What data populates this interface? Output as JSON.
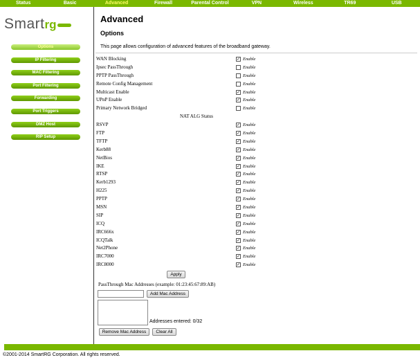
{
  "topnav": {
    "items": [
      {
        "label": "Status",
        "active": false
      },
      {
        "label": "Basic",
        "active": false
      },
      {
        "label": "Advanced",
        "active": true
      },
      {
        "label": "Firewall",
        "active": false
      },
      {
        "label": "Parental Control",
        "active": false
      },
      {
        "label": "VPN",
        "active": false
      },
      {
        "label": "Wireless",
        "active": false
      },
      {
        "label": "TR69",
        "active": false
      },
      {
        "label": "USB",
        "active": false
      }
    ]
  },
  "logo": {
    "text_main": "Smart",
    "text_accent": "rg"
  },
  "sidebar": {
    "items": [
      {
        "label": "Options",
        "active": true
      },
      {
        "label": "IP Filtering",
        "active": false
      },
      {
        "label": "MAC Filtering",
        "active": false
      },
      {
        "label": "Port Filtering",
        "active": false
      },
      {
        "label": "Forwarding",
        "active": false
      },
      {
        "label": "Port Triggers",
        "active": false
      },
      {
        "label": "DMZ Host",
        "active": false
      },
      {
        "label": "RIP Setup",
        "active": false
      }
    ]
  },
  "main": {
    "title": "Advanced",
    "subtitle": "Options",
    "intro": "This page allows configuration of advanced features of the broadband gateway.",
    "enable_label": "Enable",
    "options": [
      {
        "label": "WAN Blocking",
        "checked": true
      },
      {
        "label": "Ipsec PassThrough",
        "checked": false
      },
      {
        "label": "PPTP PassThrough",
        "checked": false
      },
      {
        "label": "Remote Config Management",
        "checked": false
      },
      {
        "label": "Multicast Enable",
        "checked": true
      },
      {
        "label": "UPnP Enable",
        "checked": true
      },
      {
        "label": "Primary Network Bridged",
        "checked": false
      }
    ],
    "nat_alg_heading": "NAT ALG Status",
    "nat_alg": [
      {
        "label": "RSVP",
        "checked": true
      },
      {
        "label": "FTP",
        "checked": true
      },
      {
        "label": "TFTP",
        "checked": true
      },
      {
        "label": "Kerb88",
        "checked": true
      },
      {
        "label": "NetBios",
        "checked": true
      },
      {
        "label": "IKE",
        "checked": true
      },
      {
        "label": "RTSP",
        "checked": true
      },
      {
        "label": "Kerb1293",
        "checked": true
      },
      {
        "label": "H225",
        "checked": true
      },
      {
        "label": "PPTP",
        "checked": true
      },
      {
        "label": "MSN",
        "checked": true
      },
      {
        "label": "SIP",
        "checked": true
      },
      {
        "label": "ICQ",
        "checked": true
      },
      {
        "label": "IRC666x",
        "checked": true
      },
      {
        "label": "ICQTalk",
        "checked": true
      },
      {
        "label": "Net2Phone",
        "checked": true
      },
      {
        "label": "IRC7000",
        "checked": true
      },
      {
        "label": "IRC8000",
        "checked": true
      }
    ],
    "apply_label": "Apply",
    "passthrough_label": "PassThrough Mac Addresses (example: 01:23:45:67:89:AB)",
    "mac_input_value": "",
    "add_mac_label": "Add Mac Address",
    "addresses_entered": "Addresses entered: 0/32",
    "remove_mac_label": "Remove Mac Address",
    "clear_all_label": "Clear All"
  },
  "footer": {
    "copyright": "©2001-2014 SmartRG Corporation. All rights reserved."
  },
  "colors": {
    "brand_green": "#7ab800",
    "active_yellow": "#ffff66"
  }
}
